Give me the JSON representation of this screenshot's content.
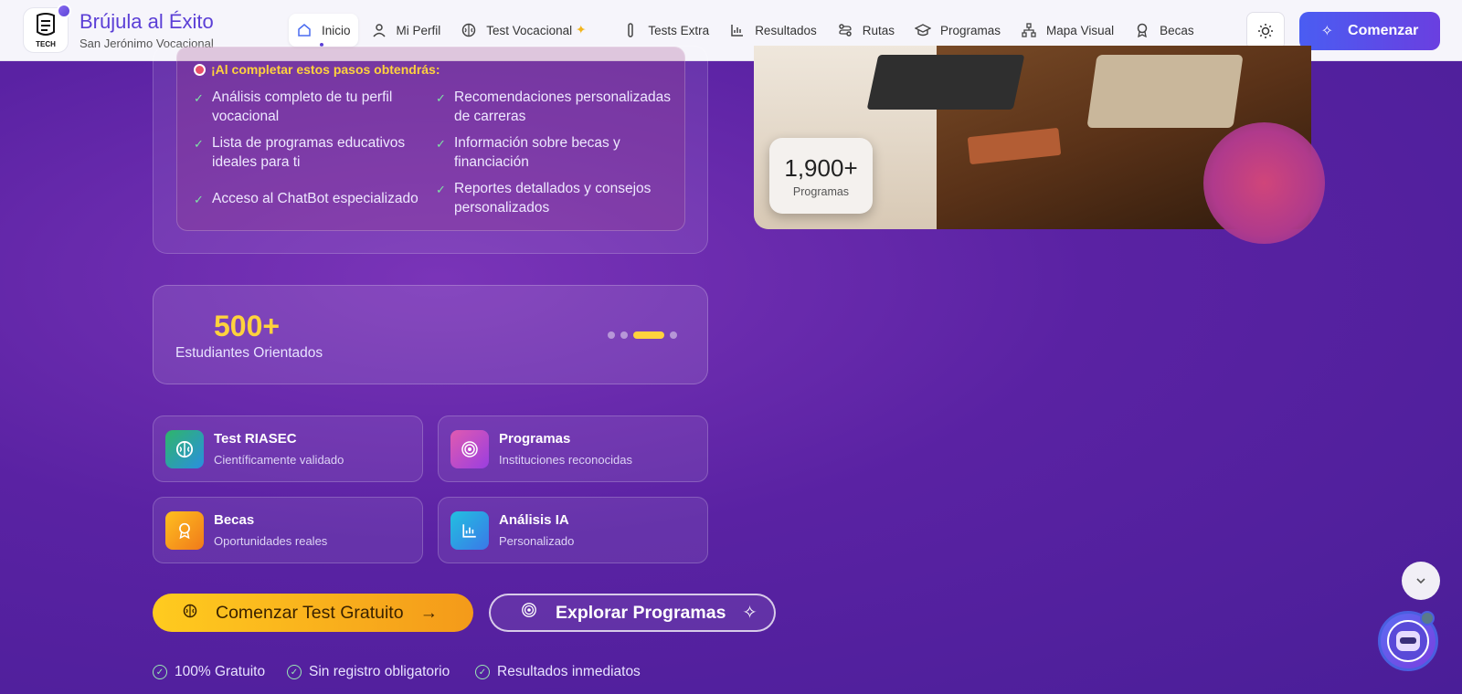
{
  "brand": {
    "title": "Brújula al Éxito",
    "subtitle": "San Jerónimo Vocacional",
    "logo_text": "TECH"
  },
  "nav": {
    "items": [
      {
        "label": "Inicio",
        "icon": "home-icon"
      },
      {
        "label": "Mi Perfil",
        "icon": "user-icon"
      },
      {
        "label": "Test Vocacional",
        "icon": "brain-icon"
      },
      {
        "label": "Tests Extra",
        "icon": "thermometer-icon"
      },
      {
        "label": "Resultados",
        "icon": "bar-chart-icon"
      },
      {
        "label": "Rutas",
        "icon": "route-icon"
      },
      {
        "label": "Programas",
        "icon": "graduation-cap-icon"
      },
      {
        "label": "Mapa Visual",
        "icon": "network-icon"
      },
      {
        "label": "Becas",
        "icon": "award-icon"
      }
    ],
    "start_label": "Comenzar"
  },
  "steps": {
    "title": "¡Al completar estos pasos obtendrás:",
    "items": [
      "Análisis completo de tu perfil vocacional",
      "Recomendaciones personalizadas de carreras",
      "Lista de programas educativos ideales para ti",
      "Información sobre becas y financiación",
      "Acceso al ChatBot especializado",
      "Reportes detallados y consejos personalizados"
    ]
  },
  "image_stat": {
    "value": "1,900+",
    "label": "Programas"
  },
  "students": {
    "value": "500+",
    "label": "Estudiantes Orientados",
    "active_dot": 2
  },
  "features": [
    {
      "title": "Test RIASEC",
      "subtitle": "Científicamente validado",
      "icon": "brain-icon",
      "color": "#2fb56a"
    },
    {
      "title": "Programas",
      "subtitle": "Instituciones reconocidas",
      "icon": "target-icon",
      "color": "#c04ad0"
    },
    {
      "title": "Becas",
      "subtitle": "Oportunidades reales",
      "icon": "award-icon",
      "color": "#f08a1a"
    },
    {
      "title": "Análisis IA",
      "subtitle": "Personalizado",
      "icon": "bar-chart-icon",
      "color": "#2ab0e0"
    }
  ],
  "cta": {
    "primary": "Comenzar Test Gratuito",
    "secondary": "Explorar Programas"
  },
  "perks": [
    "100% Gratuito",
    "Sin registro obligatorio",
    "Resultados inmediatos"
  ],
  "colors": {
    "accent": "#5b3fd6",
    "highlight": "#ffd23d",
    "background": "#5a22a3"
  }
}
